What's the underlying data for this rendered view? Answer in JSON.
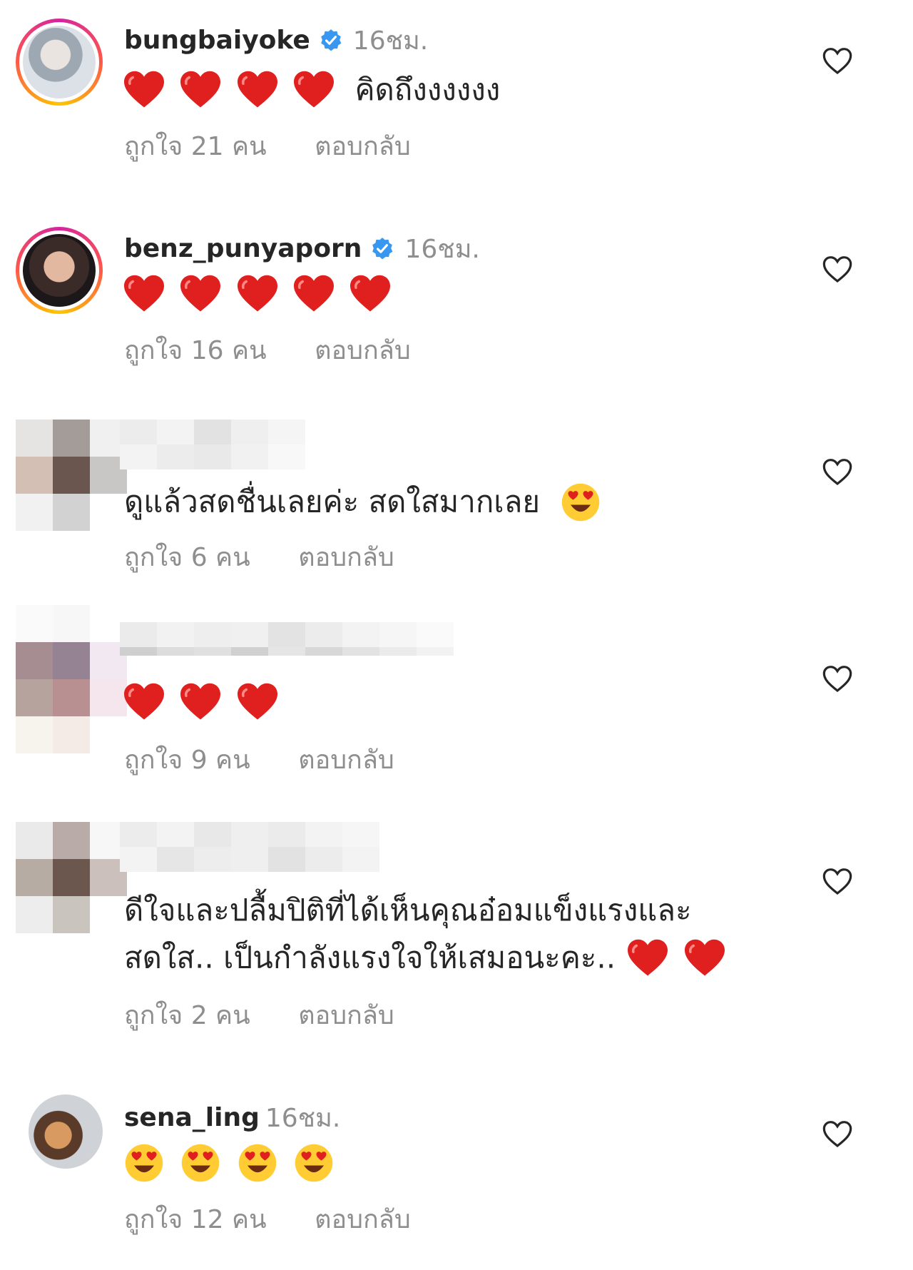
{
  "comments": [
    {
      "username": "bungbaiyoke",
      "verified": true,
      "time": "16ชม.",
      "text": "คิดถึงงงงงง",
      "hearts": 4,
      "faces": 0,
      "likes": "ถูกใจ 21 คน",
      "reply": "ตอบกลับ"
    },
    {
      "username": "benz_punyaporn",
      "verified": true,
      "time": "16ชม.",
      "text": "",
      "hearts": 5,
      "faces": 0,
      "likes": "ถูกใจ 16 คน",
      "reply": "ตอบกลับ"
    },
    {
      "username": "",
      "verified": false,
      "time": "",
      "text": "ดูแล้วสดชื่นเลยค่ะ สดใสมากเลย",
      "hearts": 0,
      "faces": 1,
      "likes": "ถูกใจ 6 คน",
      "reply": "ตอบกลับ"
    },
    {
      "username": "",
      "verified": false,
      "time": "",
      "text": "",
      "hearts": 3,
      "faces": 0,
      "likes": "ถูกใจ 9 คน",
      "reply": "ตอบกลับ"
    },
    {
      "username": "",
      "verified": false,
      "time": "",
      "text_line1": "ดีใจและปลื้มปิติที่ได้เห็นคุณอ๋อมแข็งแรงและ",
      "text_line2": "สดใส.. เป็นกำลังแรงใจให้เสมอนะคะ..",
      "hearts": 2,
      "faces": 0,
      "likes": "ถูกใจ 2 คน",
      "reply": "ตอบกลับ"
    },
    {
      "username": "sena_ling",
      "verified": false,
      "time": "16ชม.",
      "text": "",
      "hearts": 0,
      "faces": 4,
      "likes": "ถูกใจ 12 คน",
      "reply": "ตอบกลับ"
    }
  ],
  "icons": {
    "verified": "verified-badge-icon",
    "like": "heart-outline-icon",
    "heart_emoji": "red-heart-emoji",
    "face_emoji": "heart-eyes-emoji"
  },
  "colors": {
    "accent": "#3897f0",
    "muted": "#8e8e8e",
    "heart": "#e0201f"
  }
}
